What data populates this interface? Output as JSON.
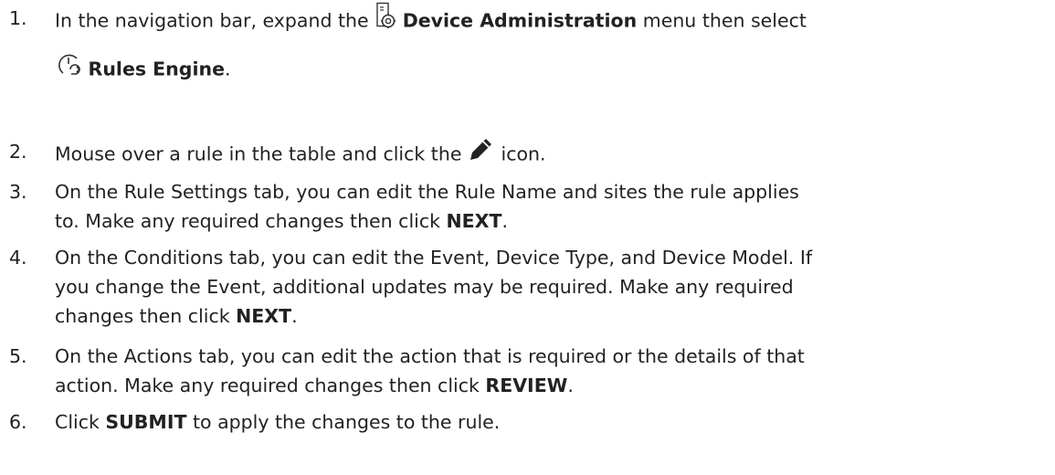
{
  "steps": [
    {
      "number": "1.",
      "pre": "In the navigation bar, expand the",
      "icon1": "device-administration-icon",
      "menu": "Device Administration",
      "mid": "menu then select",
      "icon2": "rules-engine-icon",
      "item": "Rules Engine",
      "end": "."
    },
    {
      "number": "2.",
      "pre": "Mouse over a rule in the table and click the",
      "icon": "pencil-edit-icon",
      "post": "icon."
    },
    {
      "number": "3.",
      "line1": "On the Rule Settings tab, you can edit the Rule Name and sites the rule applies",
      "line2_pre": "to. Make any required changes then click",
      "button": "NEXT",
      "end": "."
    },
    {
      "number": "4.",
      "line1": "On the Conditions tab, you can edit the Event, Device Type, and Device Model. If",
      "line2": "you change the Event, additional updates may be required. Make any required",
      "line3_pre": "changes then click",
      "button": "NEXT",
      "end": "."
    },
    {
      "number": "5.",
      "line1": "On the Actions tab, you can edit the action that is required or the details of that",
      "line2_pre": "action. Make any required changes then click",
      "button": "REVIEW",
      "end": "."
    },
    {
      "number": "6.",
      "pre": "Click",
      "button": "SUBMIT",
      "post": "to apply the changes to the rule."
    }
  ]
}
